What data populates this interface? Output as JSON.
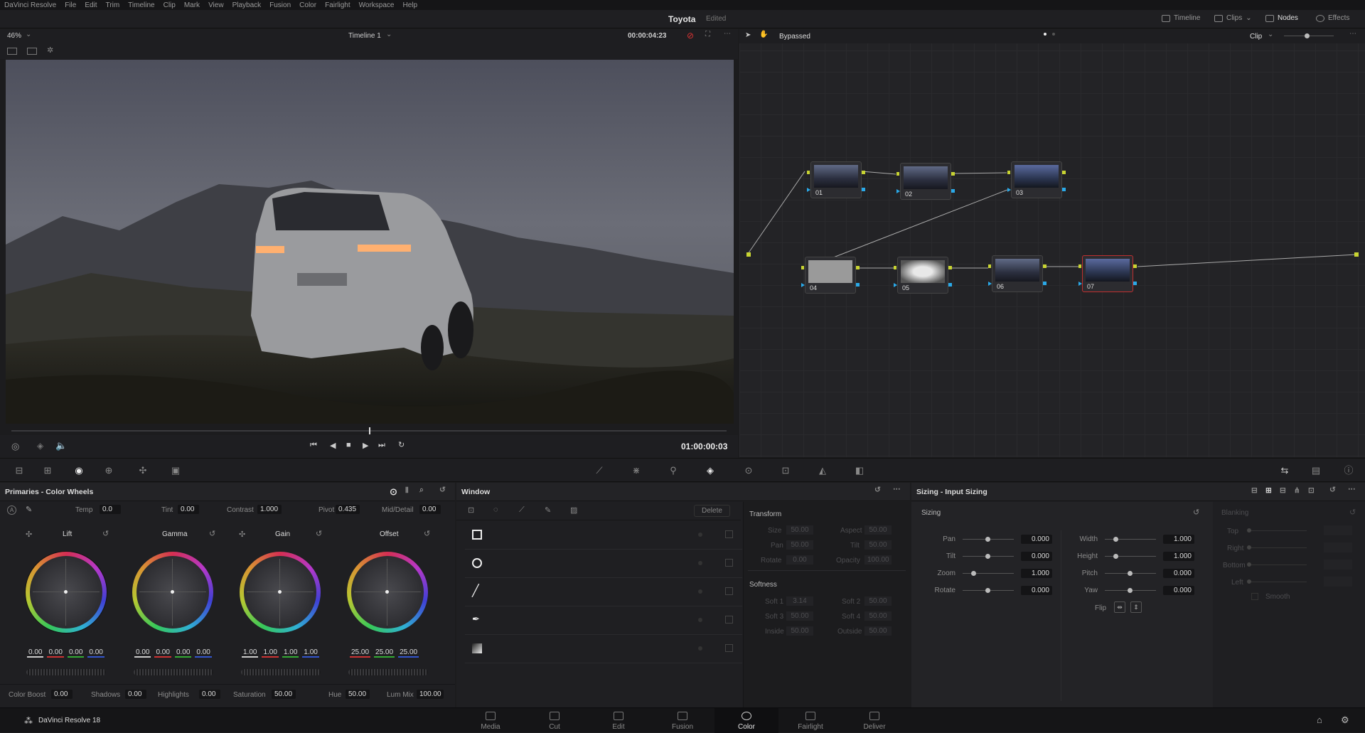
{
  "menu": [
    "DaVinci Resolve",
    "File",
    "Edit",
    "Trim",
    "Timeline",
    "Clip",
    "Mark",
    "View",
    "Playback",
    "Fusion",
    "Color",
    "Fairlight",
    "Workspace",
    "Help"
  ],
  "project": {
    "title": "Toyota",
    "status": "Edited"
  },
  "top_buttons": {
    "timeline": "Timeline",
    "clips": "Clips",
    "nodes": "Nodes",
    "effects": "Effects"
  },
  "viewer": {
    "zoom": "46%",
    "timeline": "Timeline 1",
    "timecode": "00:00:04:23",
    "playhead_tc": "01:00:00:03",
    "playhead_fraction": 0.5
  },
  "nodes_bar": {
    "status": "Bypassed",
    "mode": "Clip"
  },
  "nodes": [
    {
      "label": "01"
    },
    {
      "label": "02"
    },
    {
      "label": "03"
    },
    {
      "label": "04"
    },
    {
      "label": "05"
    },
    {
      "label": "06"
    },
    {
      "label": "07"
    }
  ],
  "primaries": {
    "title": "Primaries - Color Wheels",
    "top": {
      "temp_label": "Temp",
      "temp": "0.0",
      "tint_label": "Tint",
      "tint": "0.00",
      "contrast_label": "Contrast",
      "contrast": "1.000",
      "pivot_label": "Pivot",
      "pivot": "0.435",
      "md_label": "Mid/Detail",
      "md": "0.00"
    },
    "wheels": [
      {
        "name": "Lift",
        "values": [
          "0.00",
          "0.00",
          "0.00",
          "0.00"
        ]
      },
      {
        "name": "Gamma",
        "values": [
          "0.00",
          "0.00",
          "0.00",
          "0.00"
        ]
      },
      {
        "name": "Gain",
        "values": [
          "1.00",
          "1.00",
          "1.00",
          "1.00"
        ]
      },
      {
        "name": "Offset",
        "values": [
          "25.00",
          "25.00",
          "25.00"
        ]
      }
    ],
    "bottom": {
      "cb_label": "Color Boost",
      "cb": "0.00",
      "sh_label": "Shadows",
      "sh": "0.00",
      "hl_label": "Highlights",
      "hl": "0.00",
      "sat_label": "Saturation",
      "sat": "50.00",
      "hue_label": "Hue",
      "hue": "50.00",
      "lm_label": "Lum Mix",
      "lm": "100.00"
    }
  },
  "window": {
    "title": "Window",
    "delete": "Delete",
    "transform": {
      "title": "Transform",
      "size_l": "Size",
      "size": "50.00",
      "aspect_l": "Aspect",
      "aspect": "50.00",
      "pan_l": "Pan",
      "pan": "50.00",
      "tilt_l": "Tilt",
      "tilt": "50.00",
      "rotate_l": "Rotate",
      "rotate": "0.00",
      "opacity_l": "Opacity",
      "opacity": "100.00"
    },
    "softness": {
      "title": "Softness",
      "s1_l": "Soft 1",
      "s1": "3.14",
      "s2_l": "Soft 2",
      "s2": "50.00",
      "s3_l": "Soft 3",
      "s3": "50.00",
      "s4_l": "Soft 4",
      "s4": "50.00",
      "in_l": "Inside",
      "in": "50.00",
      "out_l": "Outside",
      "out": "50.00"
    }
  },
  "sizing": {
    "title": "Sizing - Input Sizing",
    "section": "Sizing",
    "left": [
      {
        "label": "Pan",
        "value": "0.000"
      },
      {
        "label": "Tilt",
        "value": "0.000"
      },
      {
        "label": "Zoom",
        "value": "1.000"
      },
      {
        "label": "Rotate",
        "value": "0.000"
      }
    ],
    "right": [
      {
        "label": "Width",
        "value": "1.000"
      },
      {
        "label": "Height",
        "value": "1.000"
      },
      {
        "label": "Pitch",
        "value": "0.000"
      },
      {
        "label": "Yaw",
        "value": "0.000"
      }
    ],
    "flip": "Flip",
    "blanking": {
      "title": "Blanking",
      "top": "Top",
      "right": "Right",
      "bottom": "Bottom",
      "left": "Left",
      "smooth": "Smooth"
    }
  },
  "bottom_nav": {
    "app": "DaVinci Resolve 18",
    "pages": [
      "Media",
      "Cut",
      "Edit",
      "Fusion",
      "Color",
      "Fairlight",
      "Deliver"
    ],
    "active": "Color"
  }
}
